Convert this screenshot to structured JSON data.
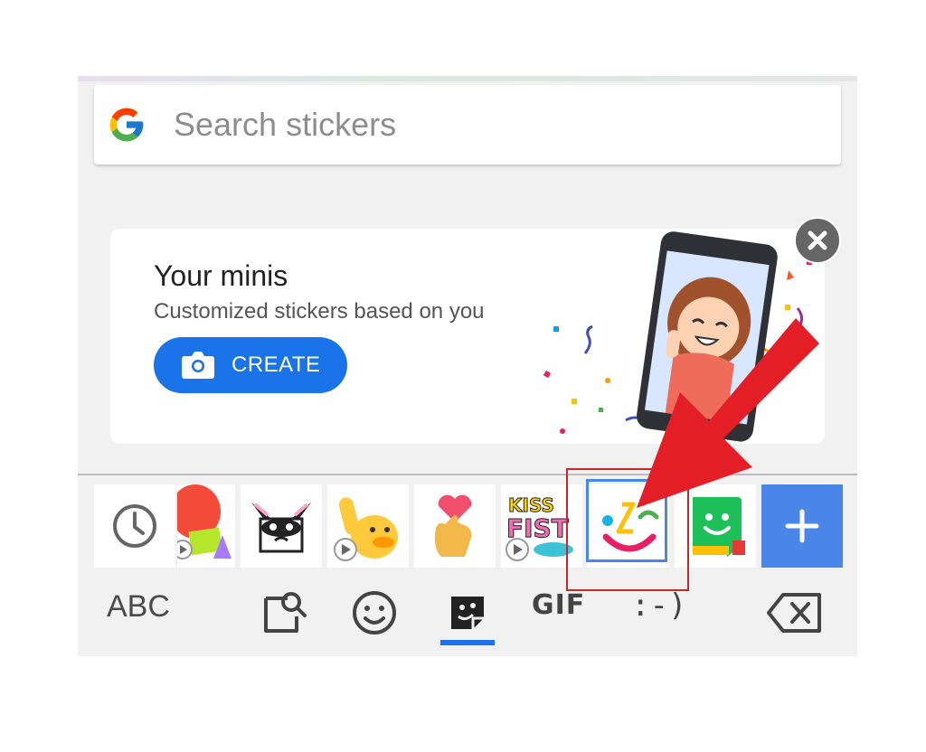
{
  "search": {
    "placeholder": "Search stickers"
  },
  "promo": {
    "title": "Your minis",
    "subtitle": "Customized stickers based on you",
    "create_label": "CREATE"
  },
  "sticker_row": [
    {
      "name": "recent",
      "icon": "clock-icon"
    },
    {
      "name": "red-creatures-pack",
      "icon": "sticker-thumbnail",
      "animated": true
    },
    {
      "name": "dog-pack",
      "icon": "sticker-thumbnail"
    },
    {
      "name": "duck-pack",
      "icon": "sticker-thumbnail",
      "animated": true
    },
    {
      "name": "heart-hand-pack",
      "icon": "sticker-thumbnail"
    },
    {
      "name": "kiss-fist-pack",
      "icon": "sticker-thumbnail",
      "animated": true
    },
    {
      "name": "minis-pack",
      "icon": "minis-face-icon",
      "selected": true
    },
    {
      "name": "bitmoji-pack",
      "icon": "bitmoji-icon"
    },
    {
      "name": "add-pack",
      "icon": "plus-icon"
    }
  ],
  "nav": {
    "abc_label": "ABC",
    "gif_label": "GIF",
    "emoticon_label": ":-)",
    "active_tab": "stickers"
  },
  "colors": {
    "accent": "#1a73e8",
    "add_tile": "#4a86e8",
    "annotation_red": "#e41e26"
  }
}
